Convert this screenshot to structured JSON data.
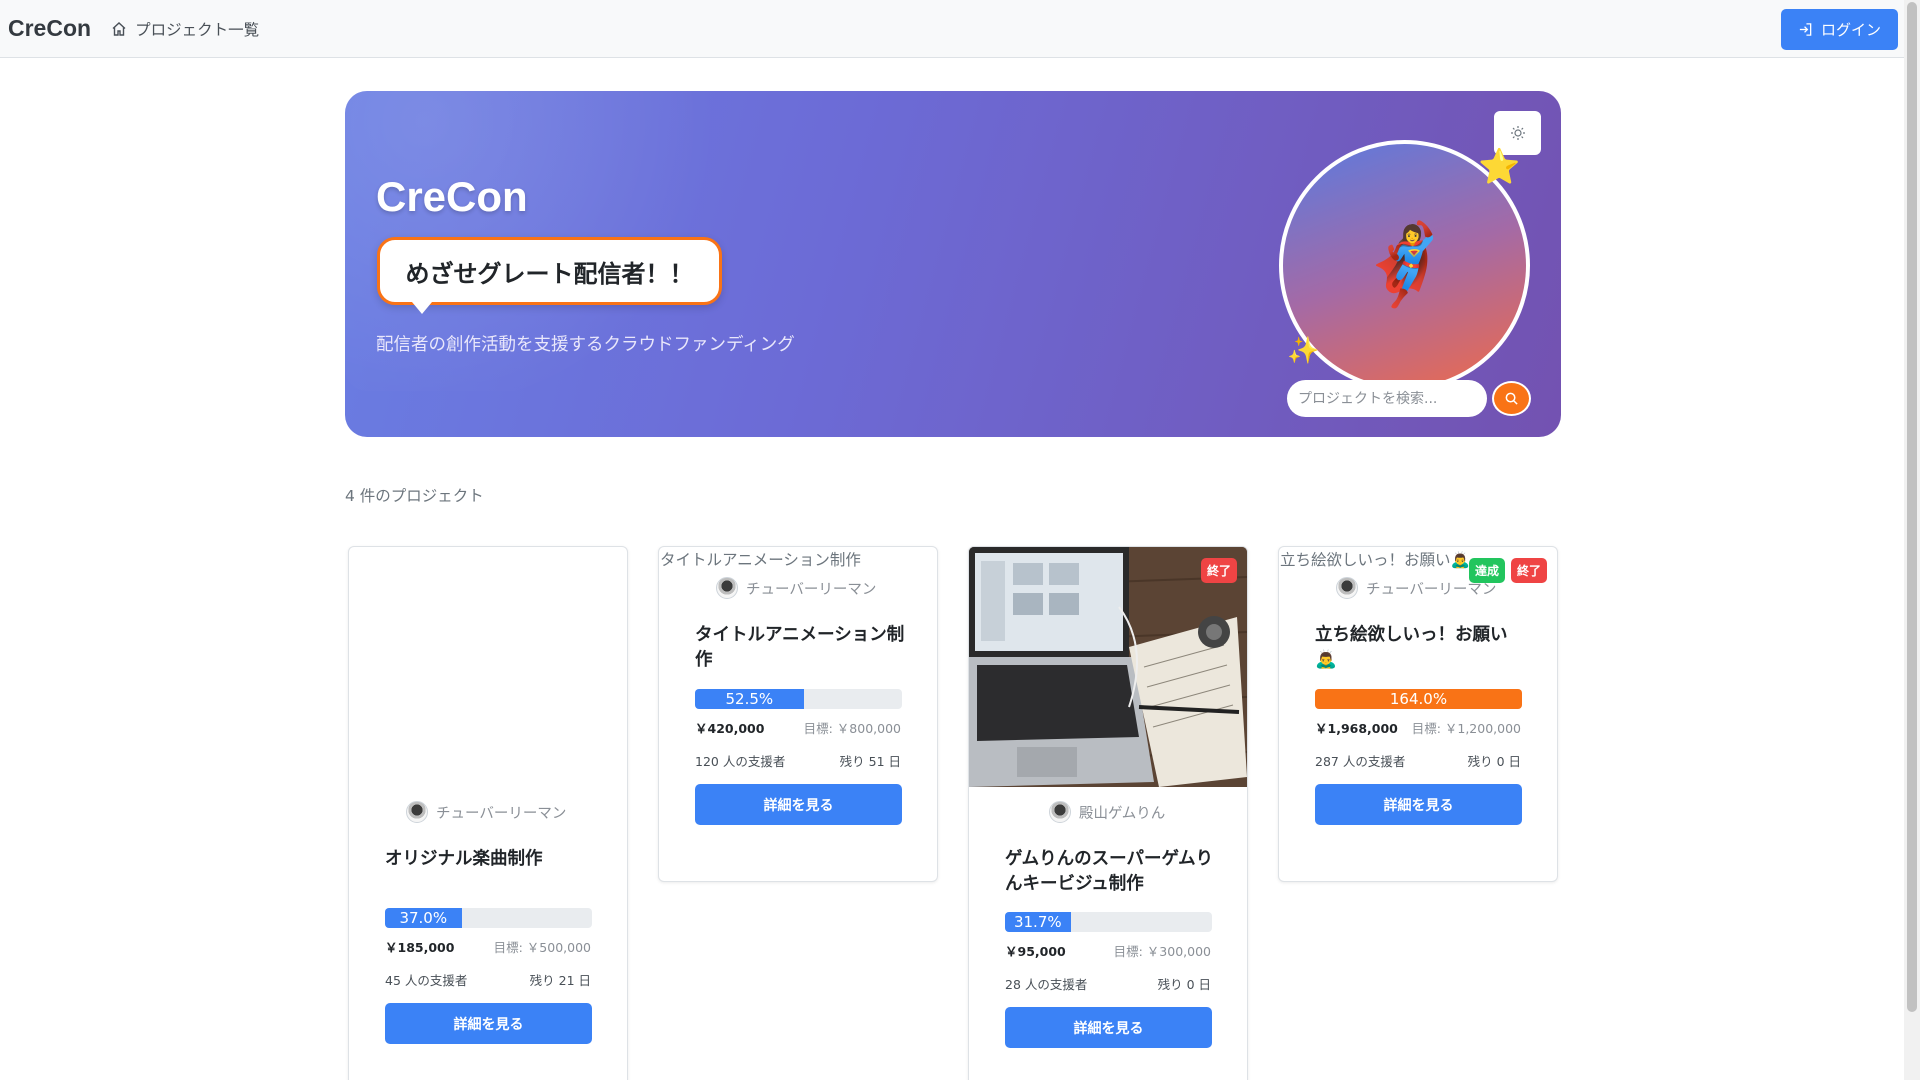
{
  "navbar": {
    "brand": "CreCon",
    "projects_link": "プロジェクト一覧",
    "login_label": "ログイン"
  },
  "hero": {
    "title": "CreCon",
    "tagline": "めざせグレート配信者！！",
    "subtitle": "配信者の創作活動を支援するクラウドファンディング",
    "mascot_emoji": "🦸‍♀️",
    "star_emoji": "⭐",
    "sparkle_emoji": "✨",
    "search_placeholder": "プロジェクトを検索..."
  },
  "project_count": "4 件のプロジェクト",
  "colors": {
    "primary": "#3b82f6",
    "accent": "#f97316",
    "success": "#22c55e",
    "danger": "#ef4444"
  },
  "projects": [
    {
      "image_alt": "",
      "creator": "チューバーリーマン",
      "title": "オリジナル楽曲制作",
      "percent_label": "37.0%",
      "percent": 37.0,
      "amount": "￥185,000",
      "goal": "目標: ￥500,000",
      "backers": "45 人の支援者",
      "remaining": "残り 21 日",
      "button": "詳細を見る"
    },
    {
      "image_alt": "タイトルアニメーション制作",
      "creator": "チューバーリーマン",
      "title": "タイトルアニメーション制作",
      "percent_label": "52.5%",
      "percent": 52.5,
      "amount": "￥420,000",
      "goal": "目標: ￥800,000",
      "backers": "120 人の支援者",
      "remaining": "残り 51 日",
      "button": "詳細を見る"
    },
    {
      "badge_end": "終了",
      "creator": "殿山ゲムりん",
      "title": "ゲムりんのスーパーゲムりんキービジュ制作",
      "percent_label": "31.7%",
      "percent": 31.7,
      "amount": "￥95,000",
      "goal": "目標: ￥300,000",
      "backers": "28 人の支援者",
      "remaining": "残り 0 日",
      "button": "詳細を見る"
    },
    {
      "image_alt": "立ち絵欲しいっ！お願い🙇‍♂️",
      "badge_done": "達成",
      "badge_end": "終了",
      "creator": "チューバーリーマン",
      "title": "立ち絵欲しいっ！お願い🙇‍♂️",
      "percent_label": "164.0%",
      "percent": 164.0,
      "amount": "￥1,968,000",
      "goal": "目標: ￥1,200,000",
      "backers": "287 人の支援者",
      "remaining": "残り 0 日",
      "button": "詳細を見る"
    }
  ]
}
